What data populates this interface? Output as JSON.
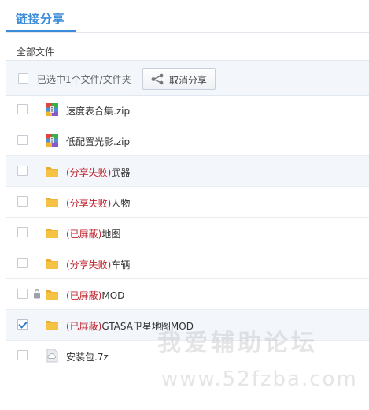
{
  "tab": {
    "title": "链接分享"
  },
  "breadcrumb": {
    "label": "全部文件"
  },
  "toolbar": {
    "selection_text": "已选中1个文件/文件夹",
    "cancel_share_label": "取消分享"
  },
  "files": [
    {
      "icon": "zip-archive-icon",
      "tag": "",
      "name": "速度表合集.zip",
      "highlighted": false,
      "checked": false,
      "locked": false
    },
    {
      "icon": "zip-archive-icon",
      "tag": "",
      "name": "低配置光影.zip",
      "highlighted": false,
      "checked": false,
      "locked": false
    },
    {
      "icon": "folder-icon",
      "tag": "(分享失败)",
      "name": "武器",
      "highlighted": true,
      "checked": false,
      "locked": false
    },
    {
      "icon": "folder-icon",
      "tag": "(分享失败)",
      "name": "人物",
      "highlighted": false,
      "checked": false,
      "locked": false
    },
    {
      "icon": "folder-icon",
      "tag": "(已屏蔽)",
      "name": "地图",
      "highlighted": false,
      "checked": false,
      "locked": false
    },
    {
      "icon": "folder-icon",
      "tag": "(分享失败)",
      "name": "车辆",
      "highlighted": false,
      "checked": false,
      "locked": false
    },
    {
      "icon": "folder-icon",
      "tag": "(已屏蔽)",
      "name": "MOD",
      "highlighted": false,
      "checked": false,
      "locked": true
    },
    {
      "icon": "folder-icon",
      "tag": "(已屏蔽)",
      "name": "GTASA卫星地图MOD",
      "highlighted": true,
      "checked": true,
      "locked": false
    },
    {
      "icon": "cloud-file-icon",
      "tag": "",
      "name": "安装包.7z",
      "highlighted": false,
      "checked": false,
      "locked": false
    }
  ],
  "watermark": {
    "line1": "我爱辅助论坛",
    "line2": "www.52fzba.com"
  },
  "colors": {
    "accent": "#3b8cd9",
    "tag_red": "#c0242e",
    "folder": "#f5c244",
    "highlight_row": "#f3f7fc"
  }
}
